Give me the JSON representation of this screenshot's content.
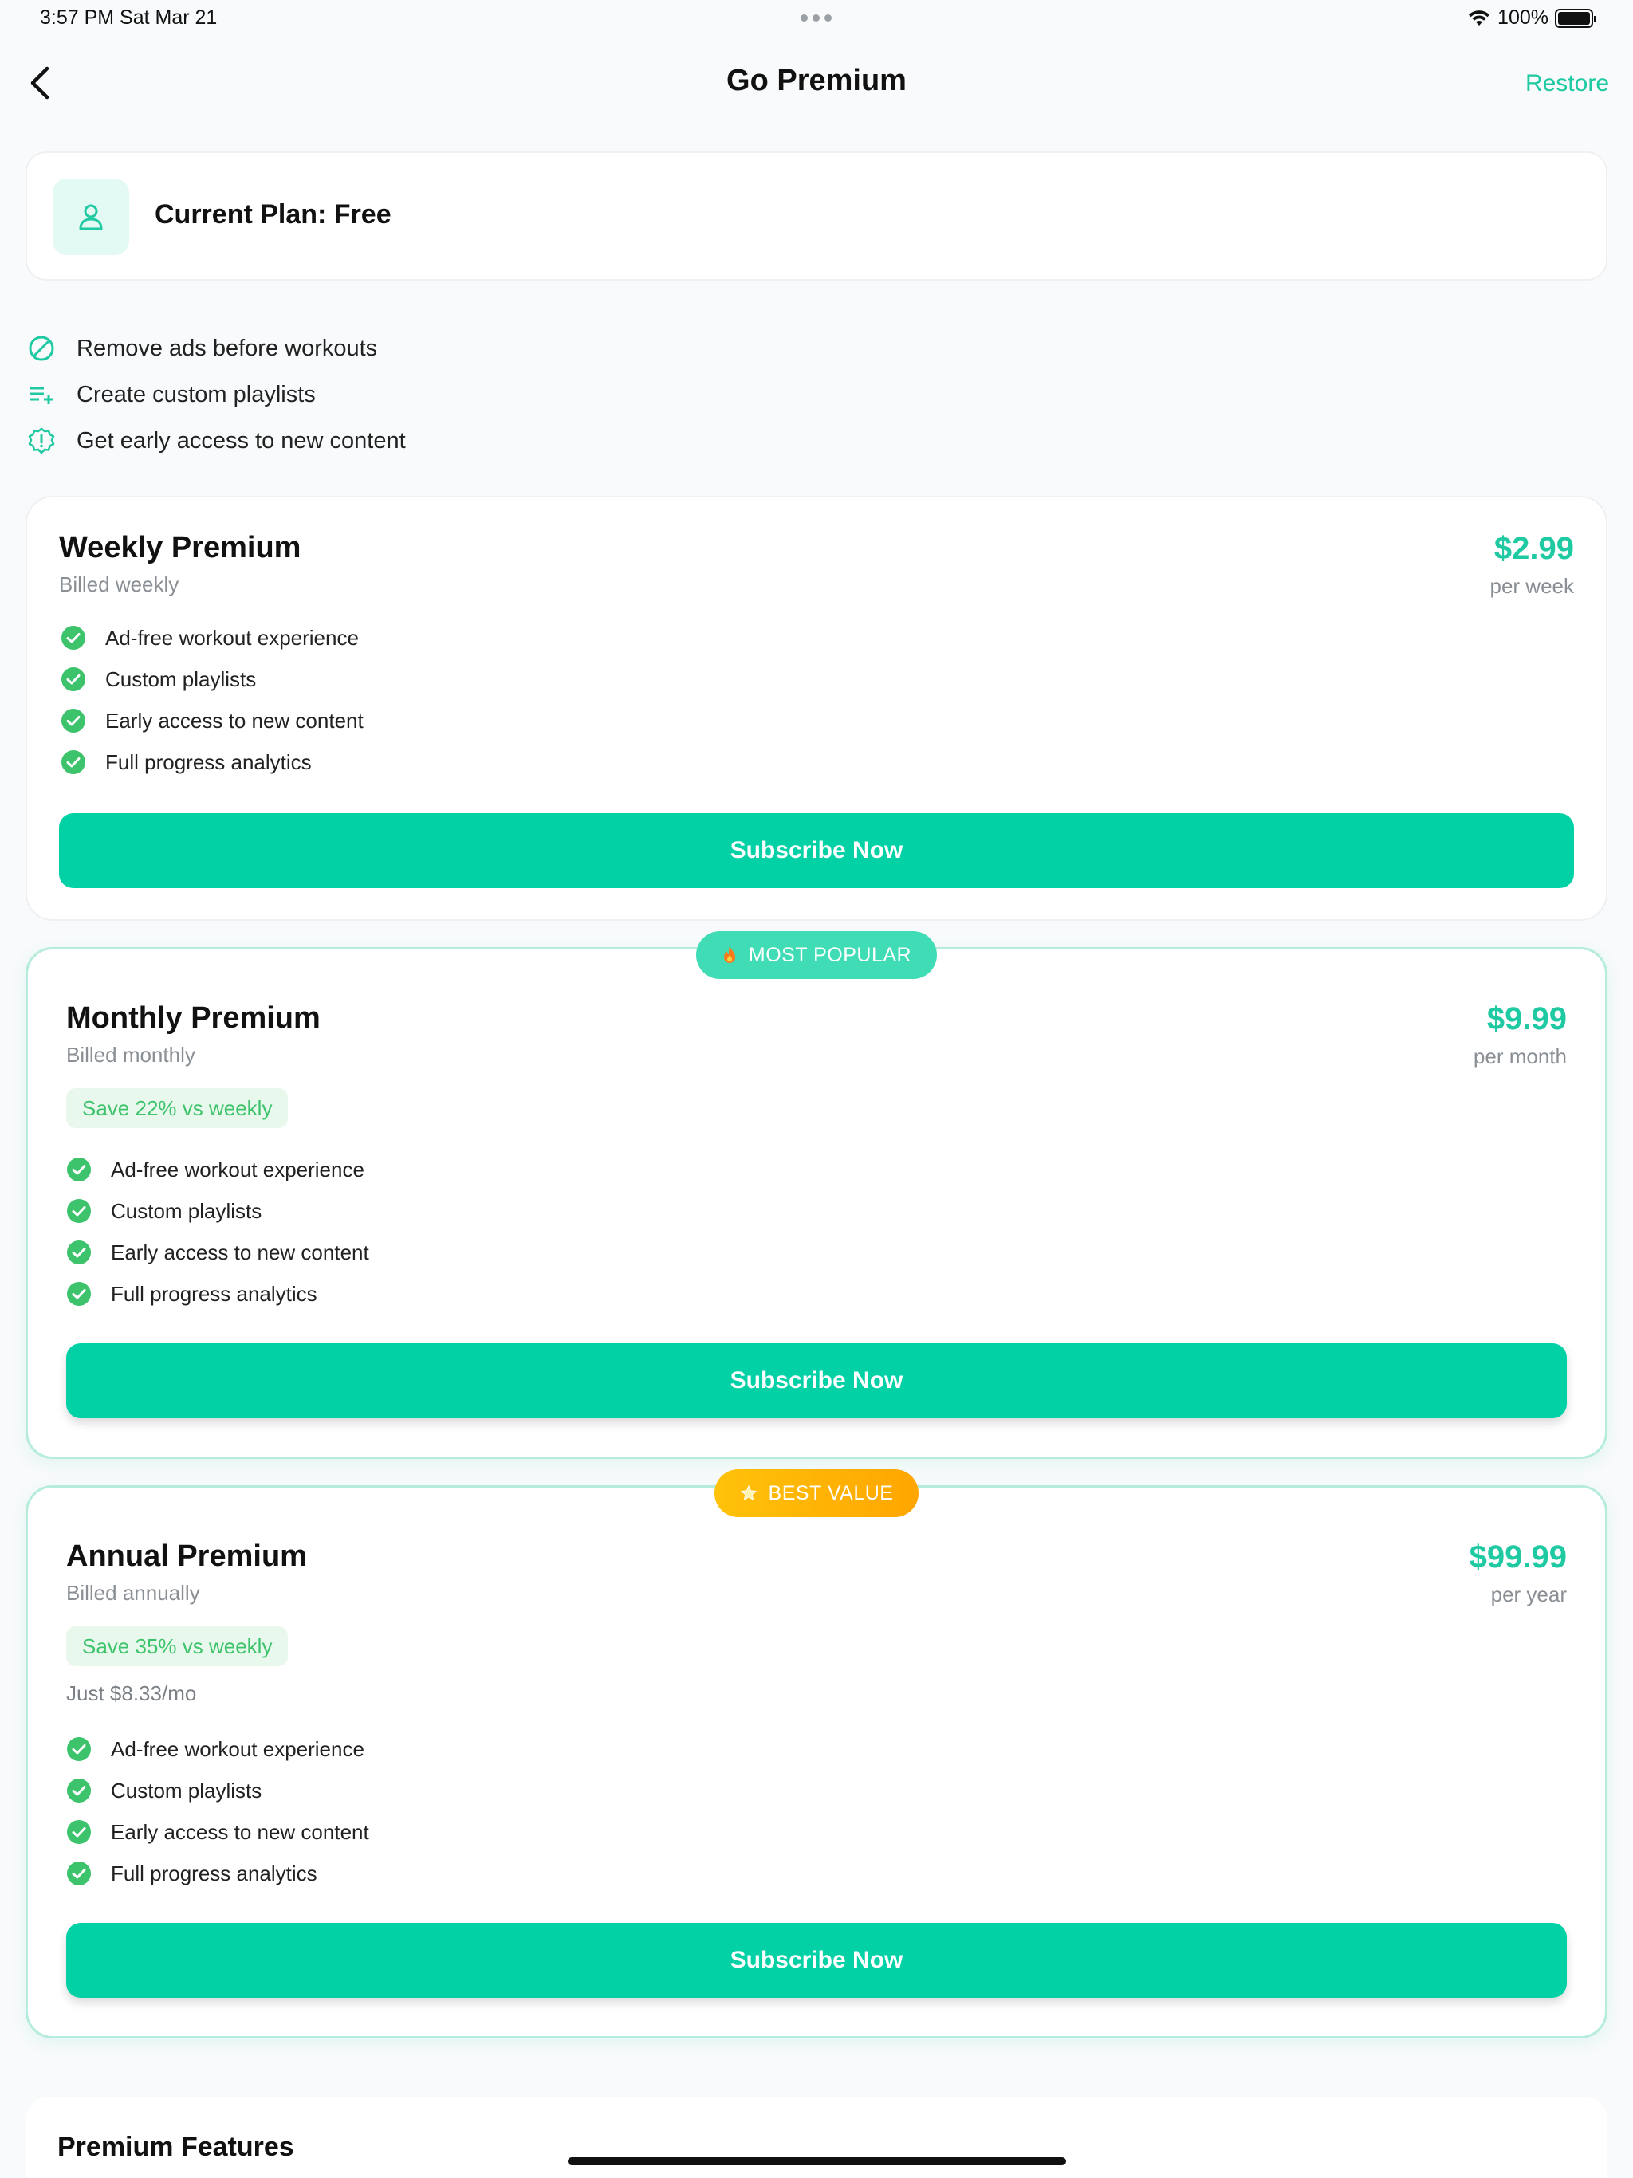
{
  "status_bar": {
    "time": "3:57 PM   Sat Mar 21",
    "battery": "100%"
  },
  "nav": {
    "title": "Go Premium",
    "restore_label": "Restore",
    "back_icon": "chevron-left-icon"
  },
  "current_plan": {
    "label": "Current Plan: Free",
    "icon": "user-icon"
  },
  "benefits": [
    {
      "icon": "no-ads-icon",
      "text": "Remove ads before workouts"
    },
    {
      "icon": "playlist-add-icon",
      "text": "Create custom playlists"
    },
    {
      "icon": "new-badge-icon",
      "text": "Get early access to new content"
    }
  ],
  "plans": {
    "weekly": {
      "name": "Weekly Premium",
      "billing": "Billed weekly",
      "price": "$2.99",
      "period": "per week",
      "features": [
        "Ad-free workout experience",
        "Custom playlists",
        "Early access to new content",
        "Full progress analytics"
      ],
      "button": "Subscribe Now"
    },
    "monthly": {
      "ribbon": "MOST POPULAR",
      "ribbon_icon": "fire-icon",
      "name": "Monthly Premium",
      "billing": "Billed monthly",
      "price": "$9.99",
      "period": "per month",
      "save": "Save 22% vs weekly",
      "features": [
        "Ad-free workout experience",
        "Custom playlists",
        "Early access to new content",
        "Full progress analytics"
      ],
      "button": "Subscribe Now"
    },
    "annual": {
      "ribbon": "BEST VALUE",
      "ribbon_icon": "star-icon",
      "name": "Annual Premium",
      "billing": "Billed annually",
      "price": "$99.99",
      "period": "per year",
      "save": "Save 35% vs weekly",
      "note": "Just $8.33/mo",
      "features": [
        "Ad-free workout experience",
        "Custom playlists",
        "Early access to new content",
        "Full progress analytics"
      ],
      "button": "Subscribe Now"
    }
  },
  "premium_features": {
    "title": "Premium Features"
  },
  "colors": {
    "accent": "#02d1a6",
    "accent_text": "#1fc9a2",
    "check_green": "#3cc36b",
    "best_value": "#ffb300"
  }
}
